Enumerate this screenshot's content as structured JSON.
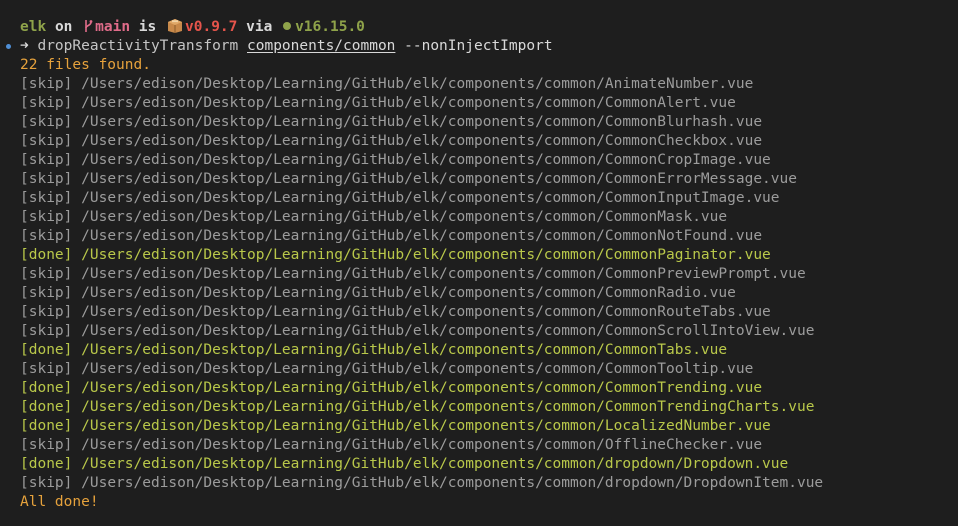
{
  "prompt": {
    "dir": "elk",
    "on": "on",
    "branch": "main",
    "is": "is",
    "package_version": "v0.9.7",
    "via": "via",
    "node_version": "v16.15.0",
    "branch_icon": "git-branch-icon",
    "package_icon": "package-icon",
    "node_icon": "node-dot-icon"
  },
  "command": {
    "arrow": "➜",
    "name": "dropReactivityTransform",
    "arg": "components/common",
    "flag": "--nonInjectImport"
  },
  "summary": "22 files found.",
  "results": [
    {
      "status": "[skip]",
      "path": "/Users/edison/Desktop/Learning/GitHub/elk/components/common/AnimateNumber.vue"
    },
    {
      "status": "[skip]",
      "path": "/Users/edison/Desktop/Learning/GitHub/elk/components/common/CommonAlert.vue"
    },
    {
      "status": "[skip]",
      "path": "/Users/edison/Desktop/Learning/GitHub/elk/components/common/CommonBlurhash.vue"
    },
    {
      "status": "[skip]",
      "path": "/Users/edison/Desktop/Learning/GitHub/elk/components/common/CommonCheckbox.vue"
    },
    {
      "status": "[skip]",
      "path": "/Users/edison/Desktop/Learning/GitHub/elk/components/common/CommonCropImage.vue"
    },
    {
      "status": "[skip]",
      "path": "/Users/edison/Desktop/Learning/GitHub/elk/components/common/CommonErrorMessage.vue"
    },
    {
      "status": "[skip]",
      "path": "/Users/edison/Desktop/Learning/GitHub/elk/components/common/CommonInputImage.vue"
    },
    {
      "status": "[skip]",
      "path": "/Users/edison/Desktop/Learning/GitHub/elk/components/common/CommonMask.vue"
    },
    {
      "status": "[skip]",
      "path": "/Users/edison/Desktop/Learning/GitHub/elk/components/common/CommonNotFound.vue"
    },
    {
      "status": "[done]",
      "path": "/Users/edison/Desktop/Learning/GitHub/elk/components/common/CommonPaginator.vue"
    },
    {
      "status": "[skip]",
      "path": "/Users/edison/Desktop/Learning/GitHub/elk/components/common/CommonPreviewPrompt.vue"
    },
    {
      "status": "[skip]",
      "path": "/Users/edison/Desktop/Learning/GitHub/elk/components/common/CommonRadio.vue"
    },
    {
      "status": "[skip]",
      "path": "/Users/edison/Desktop/Learning/GitHub/elk/components/common/CommonRouteTabs.vue"
    },
    {
      "status": "[skip]",
      "path": "/Users/edison/Desktop/Learning/GitHub/elk/components/common/CommonScrollIntoView.vue"
    },
    {
      "status": "[done]",
      "path": "/Users/edison/Desktop/Learning/GitHub/elk/components/common/CommonTabs.vue"
    },
    {
      "status": "[skip]",
      "path": "/Users/edison/Desktop/Learning/GitHub/elk/components/common/CommonTooltip.vue"
    },
    {
      "status": "[done]",
      "path": "/Users/edison/Desktop/Learning/GitHub/elk/components/common/CommonTrending.vue"
    },
    {
      "status": "[done]",
      "path": "/Users/edison/Desktop/Learning/GitHub/elk/components/common/CommonTrendingCharts.vue"
    },
    {
      "status": "[done]",
      "path": "/Users/edison/Desktop/Learning/GitHub/elk/components/common/LocalizedNumber.vue"
    },
    {
      "status": "[skip]",
      "path": "/Users/edison/Desktop/Learning/GitHub/elk/components/common/OfflineChecker.vue"
    },
    {
      "status": "[done]",
      "path": "/Users/edison/Desktop/Learning/GitHub/elk/components/common/dropdown/Dropdown.vue"
    },
    {
      "status": "[skip]",
      "path": "/Users/edison/Desktop/Learning/GitHub/elk/components/common/dropdown/DropdownItem.vue"
    }
  ],
  "footer": "All done!",
  "colors": {
    "background": "#1e1e1e",
    "done": "#b9c84a",
    "skip": "#9c9c9c",
    "summary": "#e6a23c",
    "branch": "#e06c8a",
    "package_version": "#e5544b",
    "node": "#8fa34a",
    "marker": "#4f8fd6"
  }
}
